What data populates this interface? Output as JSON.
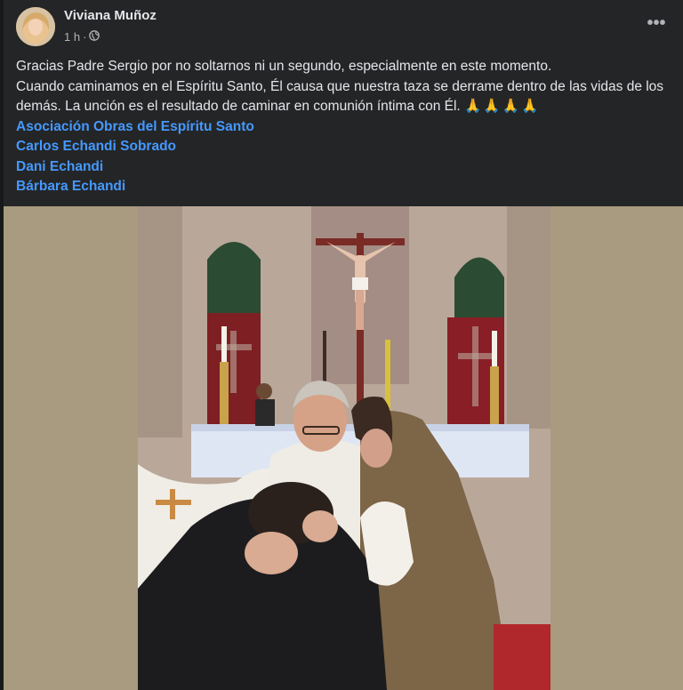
{
  "post": {
    "author": "Viviana Muñoz",
    "time": "1 h",
    "separator": "·",
    "audience_icon": "globe-icon",
    "more_icon": "more-options-icon",
    "text_line1": "Gracias Padre Sergio por no soltarnos ni un segundo, especialmente en este momento.",
    "text_line2": "Cuando caminamos en el Espíritu Santo, Él causa que nuestra taza se derrame dentro de las vidas de los demás. La unción es el resultado de caminar en comunión íntima con Él.",
    "text_emoji": "🙏🙏🙏🙏",
    "mentions": [
      "Asociación Obras del Espíritu Santo",
      "Carlos Echandi Sobrado",
      "Dani Echandi",
      "Bárbara Echandi"
    ]
  },
  "colors": {
    "background": "#242526",
    "text": "#e4e6eb",
    "secondary": "#b0b3b8",
    "link": "#4599ff",
    "photo_letterbox": "#a89b7f"
  }
}
